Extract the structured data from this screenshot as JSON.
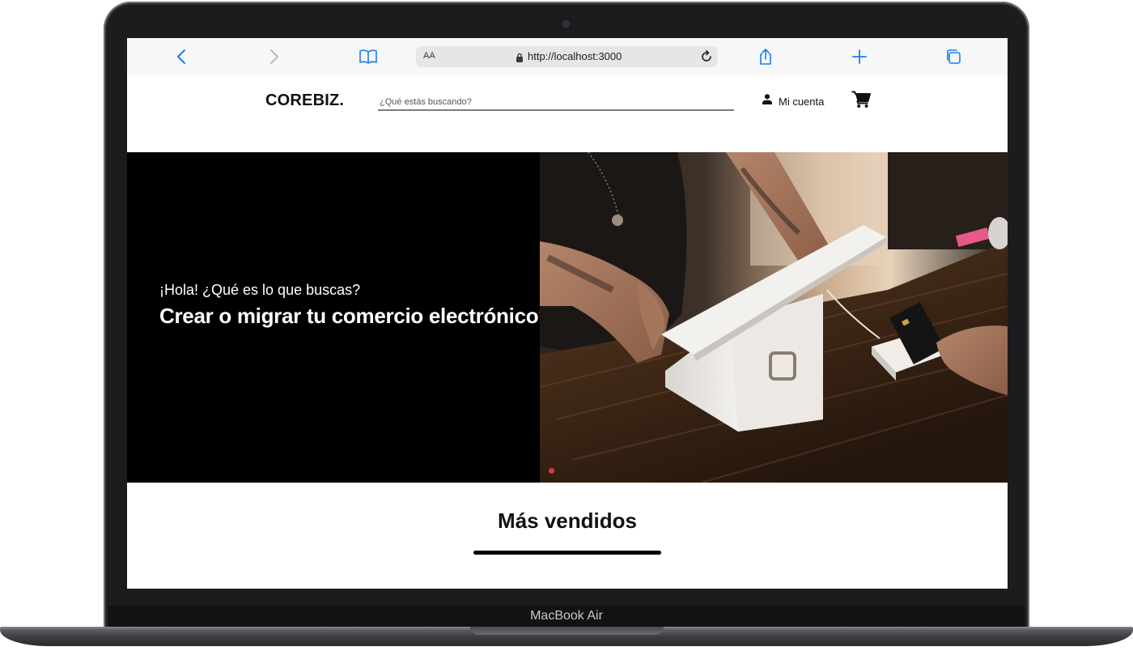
{
  "device": {
    "label": "MacBook Air"
  },
  "browser": {
    "text_size_label": "AA",
    "url": "http://localhost:3000",
    "accent_color": "#1a7cf2"
  },
  "site": {
    "logo": "COREBIZ.",
    "search": {
      "placeholder": "¿Qué estás buscando?",
      "value": ""
    },
    "account_label": "Mi cuenta",
    "cart_icon": "cart-icon",
    "user_icon": "user-icon"
  },
  "hero": {
    "greeting": "¡Hola! ¿Qué es lo que buscas?",
    "headline": "Crear o migrar tu comercio electrónico?",
    "slide_indicator_color": "#e0364a"
  },
  "best_sellers": {
    "title": "Más vendidos"
  }
}
